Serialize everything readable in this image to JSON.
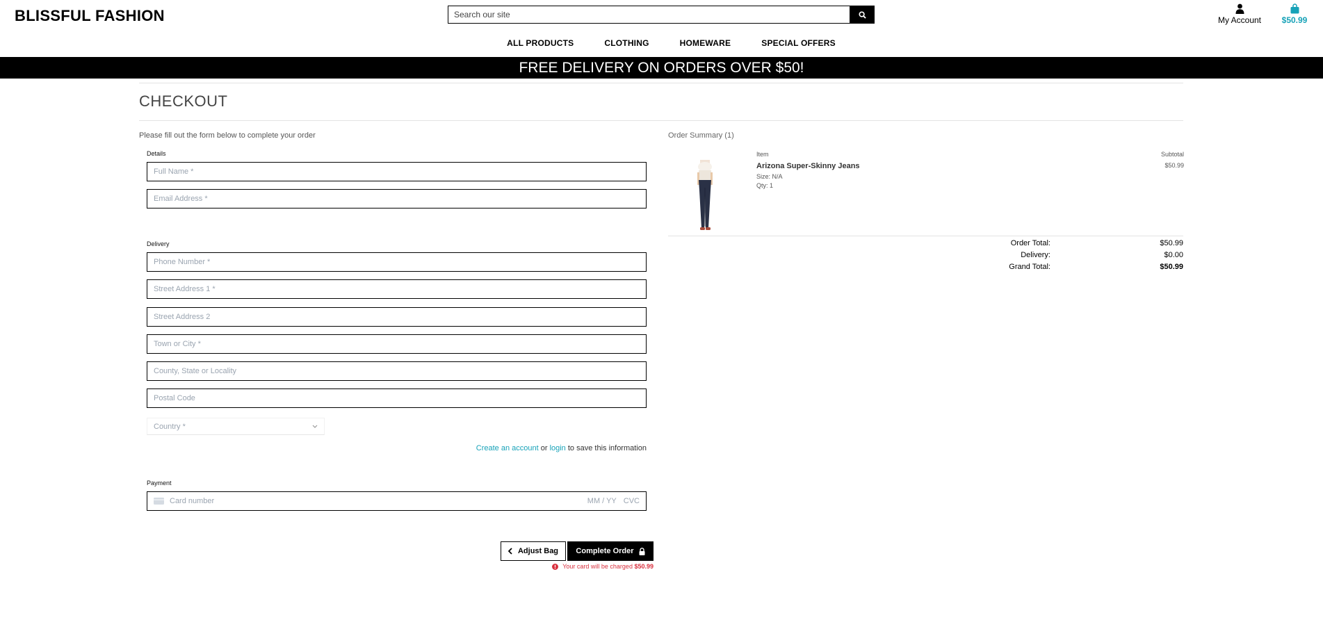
{
  "header": {
    "logo": "BLISSFUL FASHION",
    "search_placeholder": "Search our site",
    "account_label": "My Account",
    "bag_total": "$50.99"
  },
  "nav": {
    "items": [
      "ALL PRODUCTS",
      "CLOTHING",
      "HOMEWARE",
      "SPECIAL OFFERS"
    ]
  },
  "banner": "FREE DELIVERY ON ORDERS OVER $50!",
  "checkout": {
    "title": "CHECKOUT",
    "intro": "Please fill out the form below to complete your order",
    "details_label": "Details",
    "full_name_placeholder": "Full Name *",
    "email_placeholder": "Email Address *",
    "delivery_label": "Delivery",
    "phone_placeholder": "Phone Number *",
    "street1_placeholder": "Street Address 1 *",
    "street2_placeholder": "Street Address 2",
    "town_placeholder": "Town or City *",
    "county_placeholder": "County, State or Locality",
    "postcode_placeholder": "Postal Code",
    "country_selected": "Country *",
    "save_info": {
      "create_account": "Create an account",
      "or": "or",
      "login": "login",
      "suffix": "to save this information"
    },
    "payment_label": "Payment",
    "card": {
      "number_placeholder": "Card number",
      "expiry_placeholder": "MM / YY",
      "cvc_placeholder": "CVC"
    },
    "adjust_bag": "Adjust Bag",
    "complete_order": "Complete Order",
    "charge_note": "Your card will be charged",
    "charge_amount": "$50.99"
  },
  "summary": {
    "title": "Order Summary (1)",
    "col_item": "Item",
    "col_subtotal": "Subtotal",
    "product": {
      "name": "Arizona Super-Skinny Jeans",
      "size": "Size: N/A",
      "qty": "Qty: 1",
      "subtotal": "$50.99"
    },
    "order_total_label": "Order Total:",
    "order_total": "$50.99",
    "delivery_label": "Delivery:",
    "delivery": "$0.00",
    "grand_total_label": "Grand Total:",
    "grand_total": "$50.99"
  },
  "colors": {
    "accent": "#17a2b8",
    "error": "#d9303e",
    "black": "#000000"
  },
  "icons": [
    "search-icon",
    "user-icon",
    "shopping-bag-icon",
    "chevron-down-icon",
    "credit-card-icon",
    "chevron-left-icon",
    "lock-icon",
    "exclamation-circle-icon"
  ]
}
